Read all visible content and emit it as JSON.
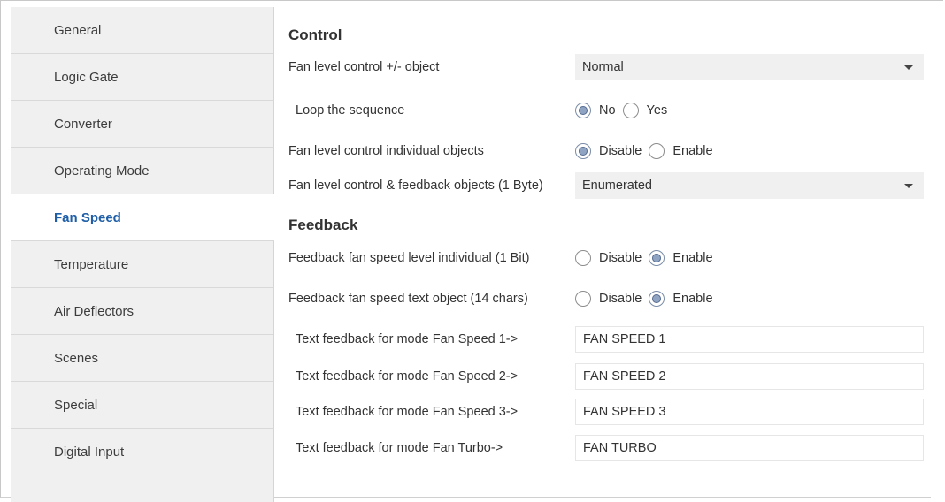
{
  "sidebar": {
    "items": [
      {
        "label": "General",
        "active": false
      },
      {
        "label": "Logic Gate",
        "active": false
      },
      {
        "label": "Converter",
        "active": false
      },
      {
        "label": "Operating Mode",
        "active": false
      },
      {
        "label": "Fan Speed",
        "active": true
      },
      {
        "label": "Temperature",
        "active": false
      },
      {
        "label": "Air Deflectors",
        "active": false
      },
      {
        "label": "Scenes",
        "active": false
      },
      {
        "label": "Special",
        "active": false
      },
      {
        "label": "Digital Input",
        "active": false
      }
    ]
  },
  "control": {
    "title": "Control",
    "fan_level_pm": {
      "label": "Fan level control +/- object",
      "value": "Normal"
    },
    "loop_sequence": {
      "label": "Loop the sequence",
      "options": [
        "No",
        "Yes"
      ],
      "selected": "No"
    },
    "individual_objects": {
      "label": "Fan level control individual objects",
      "options": [
        "Disable",
        "Enable"
      ],
      "selected": "Disable"
    },
    "byte_objects": {
      "label": "Fan level control & feedback objects (1 Byte)",
      "value": "Enumerated"
    }
  },
  "feedback": {
    "title": "Feedback",
    "level_individual": {
      "label": "Feedback fan speed level individual (1 Bit)",
      "options": [
        "Disable",
        "Enable"
      ],
      "selected": "Enable"
    },
    "text_object": {
      "label": "Feedback fan speed text object (14 chars)",
      "options": [
        "Disable",
        "Enable"
      ],
      "selected": "Enable"
    },
    "texts": [
      {
        "label": "Text feedback for mode Fan Speed 1->",
        "value": "FAN SPEED 1"
      },
      {
        "label": "Text feedback for mode Fan Speed 2->",
        "value": "FAN SPEED 2"
      },
      {
        "label": "Text feedback for mode Fan Speed 3->",
        "value": "FAN SPEED 3"
      },
      {
        "label": "Text feedback for mode Fan Turbo->",
        "value": "FAN TURBO"
      }
    ]
  },
  "colors": {
    "accent": "#1f5fa8",
    "sidebar_bg": "#f0f0f0",
    "select_bg": "#f0f0f0"
  }
}
